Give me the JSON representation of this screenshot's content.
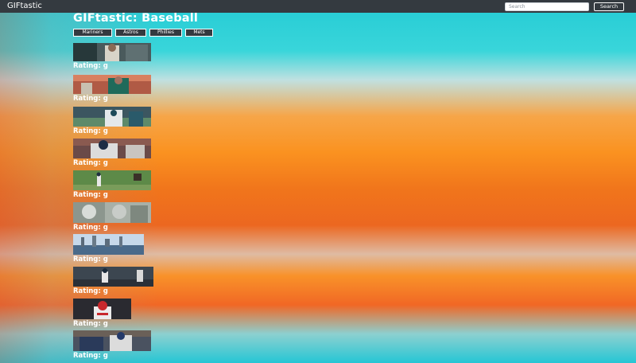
{
  "navbar": {
    "brand": "GIFtastic",
    "search_placeholder": "Search",
    "search_button": "Search"
  },
  "page": {
    "title": "GIFtastic: Baseball"
  },
  "teams": [
    "Mariners",
    "Astros",
    "Phillies",
    "Mets"
  ],
  "gifs": [
    {
      "rating_label": "Rating: g"
    },
    {
      "rating_label": "Rating: g"
    },
    {
      "rating_label": "Rating: g"
    },
    {
      "rating_label": "Rating: g"
    },
    {
      "rating_label": "Rating: g"
    },
    {
      "rating_label": "Rating: g"
    },
    {
      "rating_label": "Rating: g"
    },
    {
      "rating_label": "Rating: g"
    },
    {
      "rating_label": "Rating: g"
    },
    {
      "rating_label": "Rating: g"
    }
  ]
}
